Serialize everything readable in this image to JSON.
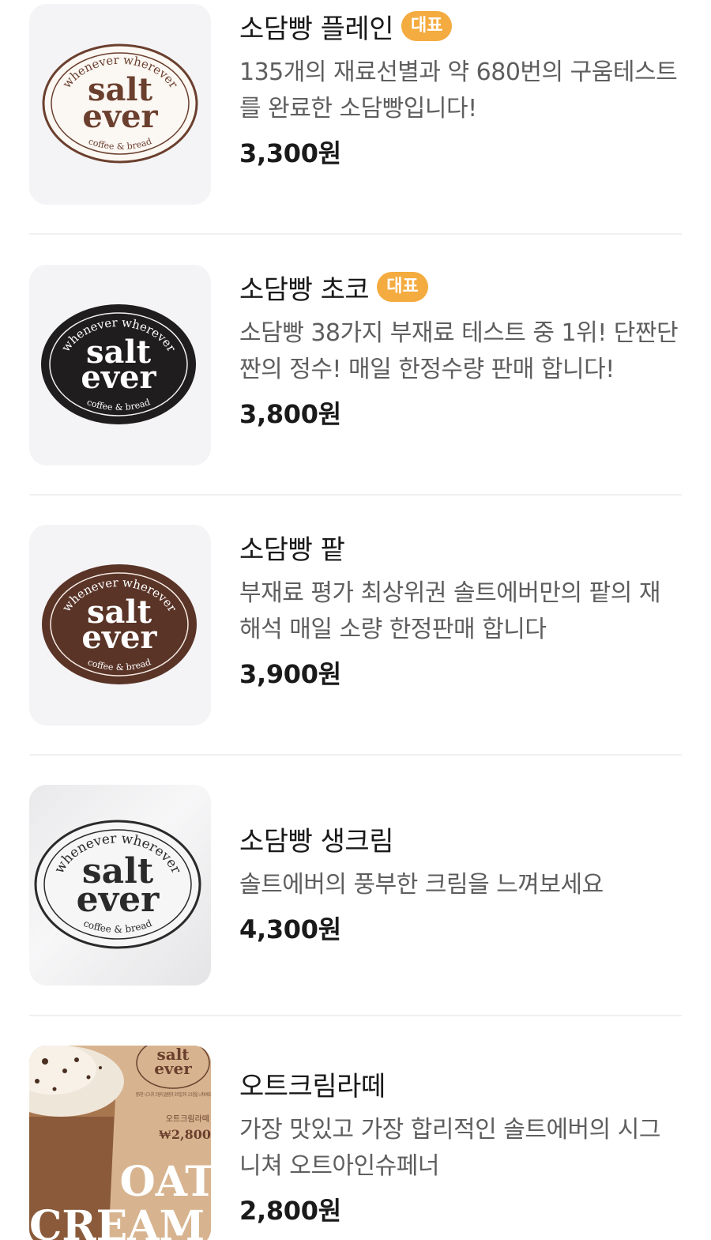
{
  "menu": {
    "items": [
      {
        "name": "소담빵 플레인",
        "badge": "대표",
        "description": "135개의 재료선별과 약 680번의 구움테스트를 완료한 소담빵입니다!",
        "price": "3,300원",
        "image": "salt-ever-logo-cream"
      },
      {
        "name": "소담빵 초코",
        "badge": "대표",
        "description": "소담빵 38가지 부재료 테스트 중 1위! 단짠단짠의 정수! 매일 한정수량 판매 합니다!",
        "price": "3,800원",
        "image": "salt-ever-logo-black"
      },
      {
        "name": "소담빵 팥",
        "badge": "",
        "description": "부재료 평가 최상위권 솔트에버만의 팥의 재해석 매일 소량 한정판매 합니다",
        "price": "3,900원",
        "image": "salt-ever-logo-brown"
      },
      {
        "name": "소담빵 생크림",
        "badge": "",
        "description": "솔트에버의 풍부한 크림을 느껴보세요",
        "price": "4,300원",
        "image": "salt-ever-logo-white"
      },
      {
        "name": "오트크림라떼",
        "badge": "",
        "description": "가장 맛있고 가장 합리적인 솔트에버의 시그니쳐 오트아인슈페너",
        "price": "2,800원",
        "image": "oat-cream-latte-photo"
      }
    ]
  },
  "logo": {
    "top_text": "whenever wherever",
    "line1": "salt",
    "line2": "ever",
    "bottom_text": "coffee & bread"
  },
  "promo": {
    "poster_text": "풍부한 시그니처 크림의 달콤함과 오트밀크의 고소함을 느껴보세요",
    "label": "오트크림라떼",
    "price": "₩2,800",
    "big_line1": "OAT",
    "big_line2": "CREAM"
  },
  "colors": {
    "badge": "#f4ab3f",
    "brown": "#6b3f2e",
    "dark_brown": "#5a3427",
    "black": "#1f1d1e",
    "poster_bg": "#d7b48f"
  }
}
